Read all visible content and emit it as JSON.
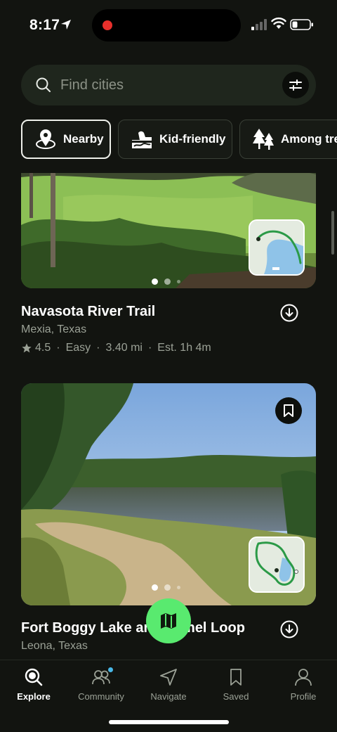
{
  "status": {
    "time": "8:17"
  },
  "search": {
    "placeholder": "Find cities"
  },
  "chips": [
    {
      "label": "Nearby",
      "active": true
    },
    {
      "label": "Kid-friendly",
      "active": false
    },
    {
      "label": "Among trees",
      "active": false
    }
  ],
  "trails": [
    {
      "title": "Navasota River Trail",
      "location": "Mexia, Texas",
      "rating": "4.5",
      "difficulty": "Easy",
      "distance": "3.40 mi",
      "est_time": "Est. 1h 4m",
      "photo_index": 1,
      "photo_count": 3
    },
    {
      "title": "Fort Boggy Lake and Camel Loop",
      "location": "Leona, Texas",
      "photo_index": 1,
      "photo_count": 3
    }
  ],
  "tabs": [
    {
      "label": "Explore",
      "icon": "search-icon",
      "active": true
    },
    {
      "label": "Community",
      "icon": "people-icon",
      "active": false,
      "badge": true
    },
    {
      "label": "Navigate",
      "icon": "navigate-icon",
      "active": false
    },
    {
      "label": "Saved",
      "icon": "bookmark-icon",
      "active": false
    },
    {
      "label": "Profile",
      "icon": "profile-icon",
      "active": false
    }
  ],
  "colors": {
    "accent": "#59ea6f",
    "background": "#121410",
    "map_fab": "#59ea6f",
    "badge": "#49b8e8"
  }
}
